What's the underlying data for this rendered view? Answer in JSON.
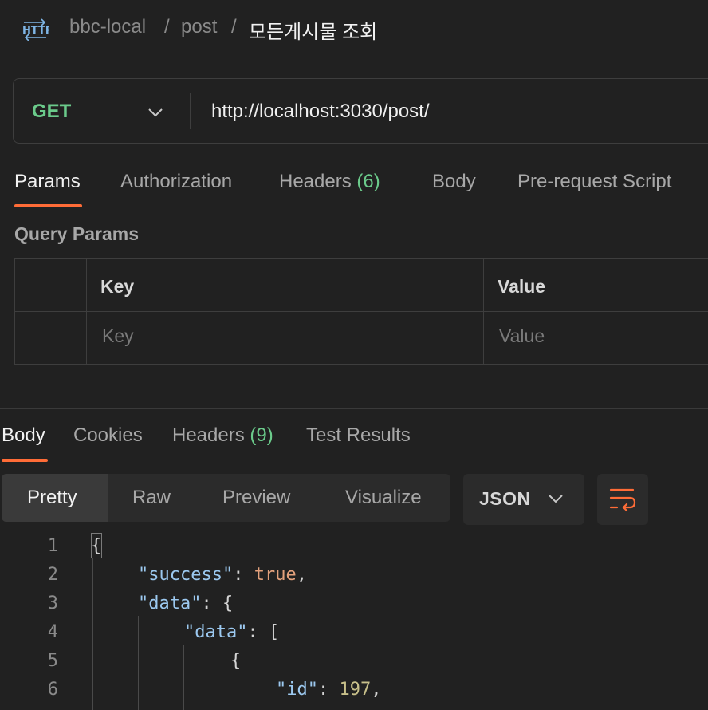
{
  "breadcrumb": {
    "icon": "http-icon",
    "workspace": "bbc-local",
    "sep1": "/",
    "collection": "post",
    "sep2": "/",
    "request": "모든게시물 조회"
  },
  "request": {
    "method": "GET",
    "url": "http://localhost:3030/post/"
  },
  "request_tabs": {
    "params": "Params",
    "authorization": "Authorization",
    "headers": "Headers",
    "headers_count": "(6)",
    "body": "Body",
    "pre_request": "Pre-request Script"
  },
  "query_params": {
    "title": "Query Params",
    "col_key": "Key",
    "col_value": "Value",
    "key_placeholder": "Key",
    "value_placeholder": "Value"
  },
  "response_tabs": {
    "body": "Body",
    "cookies": "Cookies",
    "headers": "Headers",
    "headers_count": "(9)",
    "test_results": "Test Results"
  },
  "view_modes": {
    "pretty": "Pretty",
    "raw": "Raw",
    "preview": "Preview",
    "visualize": "Visualize",
    "format": "JSON"
  },
  "code": {
    "line_numbers": [
      "1",
      "2",
      "3",
      "4",
      "5",
      "6"
    ],
    "l1_brace": "{",
    "l2_key": "\"success\"",
    "l2_colon": ": ",
    "l2_val": "true",
    "l2_comma": ",",
    "l3_key": "\"data\"",
    "l3_rest": ": {",
    "l4_key": "\"data\"",
    "l4_rest": ": [",
    "l5_brace": "{",
    "l6_key": "\"id\"",
    "l6_colon": ": ",
    "l6_val": "197",
    "l6_comma": ","
  },
  "colors": {
    "accent": "#ff6c37",
    "method_get": "#6bcb8b",
    "json_key": "#9cc9f0",
    "json_bool": "#e3a17c",
    "json_number": "#c8c08a"
  }
}
